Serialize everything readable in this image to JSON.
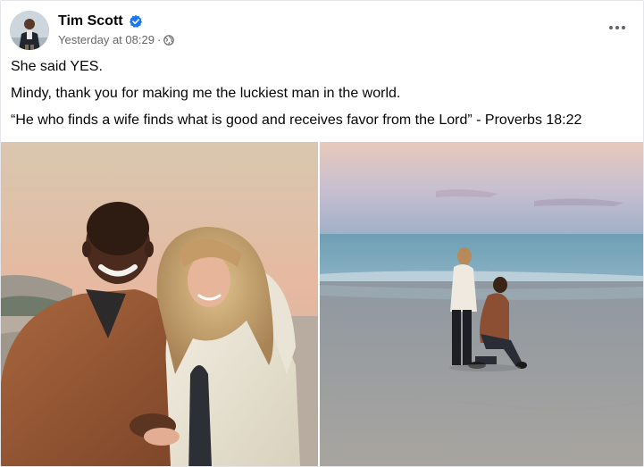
{
  "post": {
    "author": "Tim Scott",
    "timestamp": "Yesterday at 08:29",
    "separator": "·",
    "audience_icon": "globe-icon",
    "verified_icon": "verified-badge-icon",
    "more_icon": "more-options-icon",
    "lines": [
      "She said YES.",
      "Mindy, thank you for making me the luckiest man in the world.",
      "“He who finds a wife finds what is good and receives favor from the Lord” - Proverbs 18:22"
    ],
    "photos": [
      {
        "name": "photo-couple-sunset"
      },
      {
        "name": "photo-proposal-beach"
      }
    ]
  },
  "colors": {
    "verified": "#1877f2",
    "secondary_text": "#65676b"
  }
}
